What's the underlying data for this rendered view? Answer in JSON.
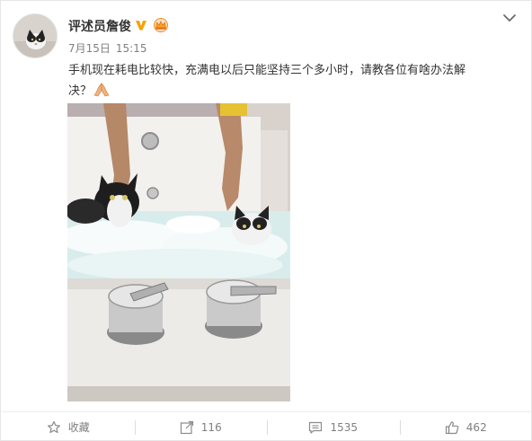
{
  "post": {
    "author": "评述员詹俊",
    "date": "7月15日",
    "time": "15:15",
    "text_line1": "手机现在耗电比较快，充满电以后只能坚持三个多小时，请教各位有啥办法解",
    "text_line2": "决？",
    "emoji": "praying-hands-emoji"
  },
  "badges": [
    "verified-v-icon",
    "crown-icon"
  ],
  "actions": {
    "favorite_label": "收藏",
    "repost_count": "116",
    "comment_count": "1535",
    "like_count": "462"
  },
  "colors": {
    "verified": "#f6a300",
    "meta_gray": "#808080",
    "text": "#333333"
  }
}
